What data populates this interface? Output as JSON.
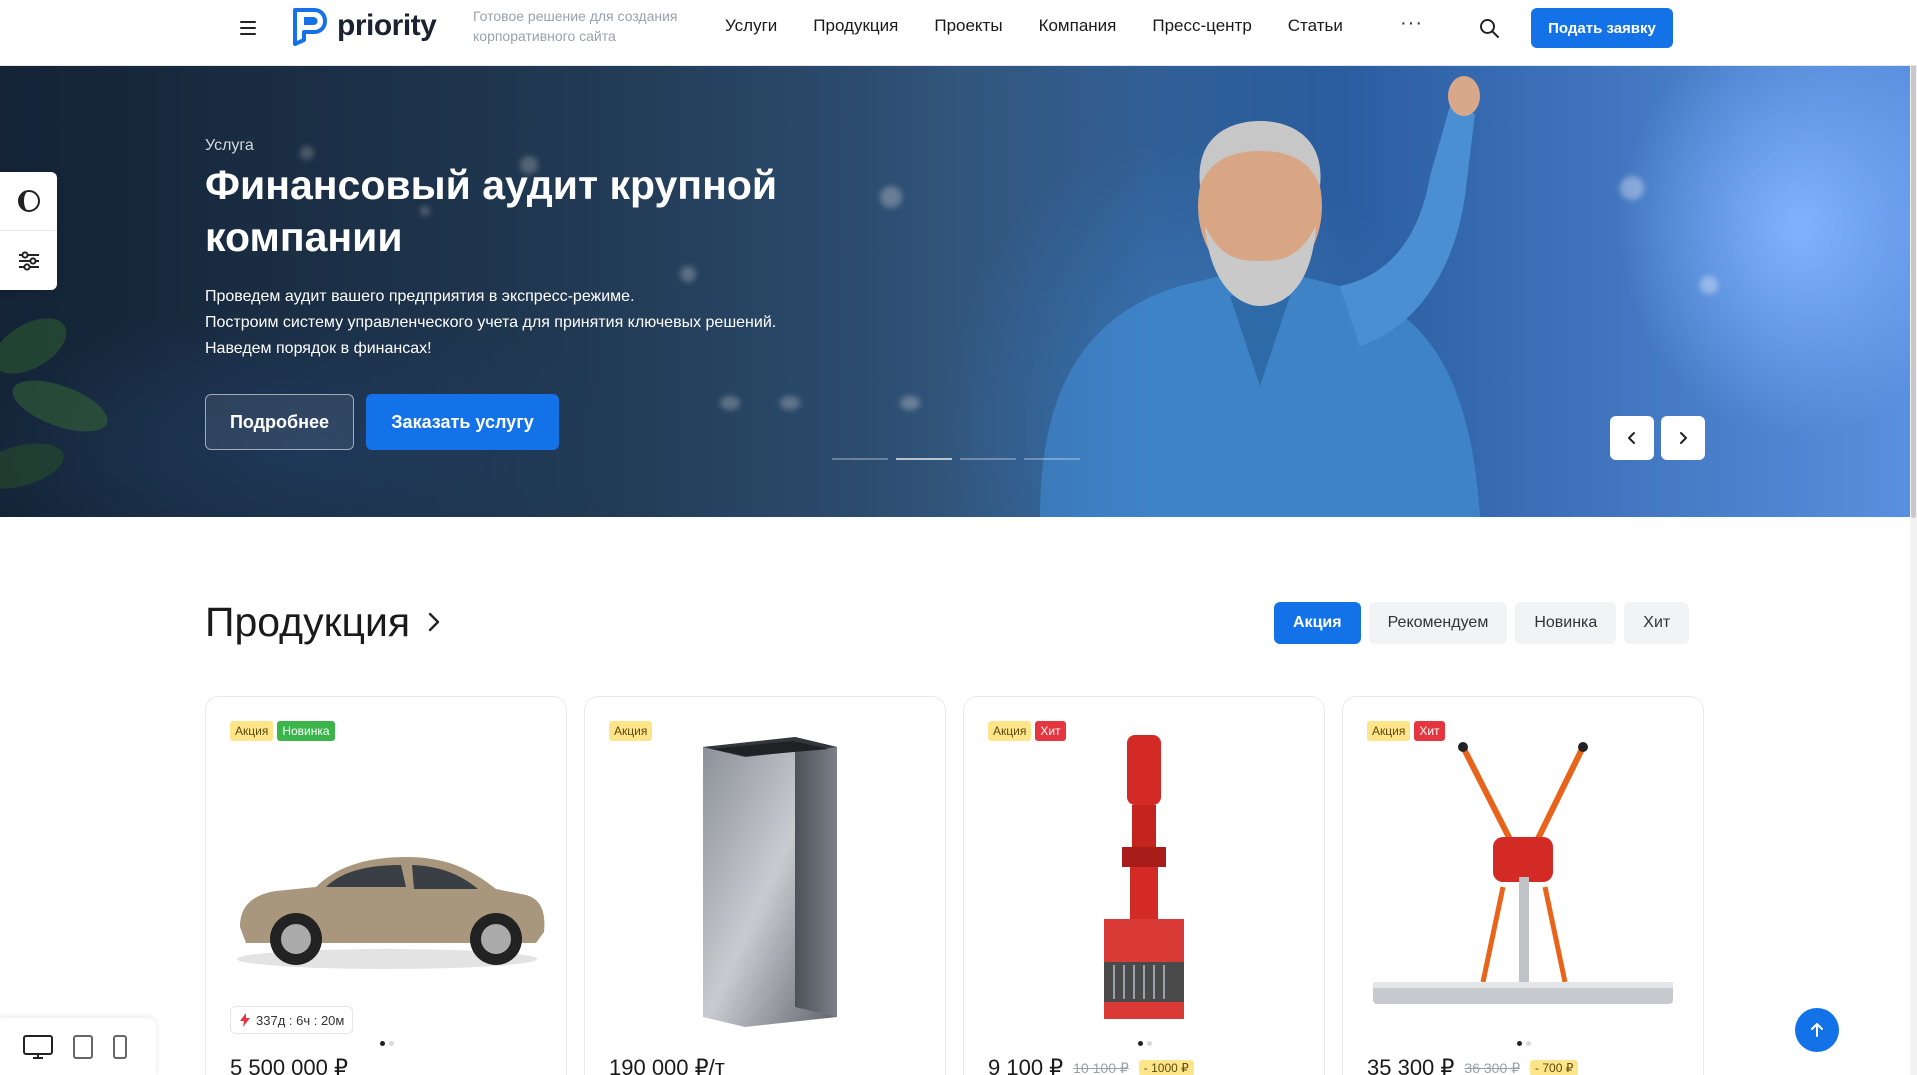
{
  "header": {
    "logo_text": "priority",
    "tagline": "Готовое решение для создания корпоративного сайта",
    "nav": [
      "Услуги",
      "Продукция",
      "Проекты",
      "Компания",
      "Пресс-центр",
      "Статьи"
    ],
    "more": "···",
    "apply_label": "Подать заявку"
  },
  "hero": {
    "eyebrow": "Услуга",
    "title": "Финансовый аудит крупной компании",
    "desc": [
      "Проведем аудит вашего предприятия в экспресс-режиме.",
      "Построим систему управленческого учета для принятия ключевых решений.",
      "Наведем порядок в финансах!"
    ],
    "more_label": "Подробнее",
    "order_label": "Заказать услугу",
    "slides_count": 4,
    "active_slide": 2
  },
  "products": {
    "title": "Продукция",
    "filters": [
      "Акция",
      "Рекомендуем",
      "Новинка",
      "Хит"
    ],
    "active_filter": "Акция",
    "items": [
      {
        "badges": [
          {
            "label": "Акция",
            "type": "sale"
          },
          {
            "label": "Новинка",
            "type": "new"
          }
        ],
        "image": "car",
        "timer": "337д : 6ч : 20м",
        "price": "5 500 000 ₽",
        "old_price": "",
        "diff": ""
      },
      {
        "badges": [
          {
            "label": "Акция",
            "type": "sale"
          }
        ],
        "image": "steel-profile-pipe",
        "timer": "",
        "price": "190 000 ₽/т",
        "old_price": "",
        "diff": ""
      },
      {
        "badges": [
          {
            "label": "Акция",
            "type": "sale"
          },
          {
            "label": "Хит",
            "type": "hit"
          }
        ],
        "image": "red-pump-grinder",
        "timer": "",
        "price": "9 100 ₽",
        "old_price": "10 100 ₽",
        "diff": "- 1000 ₽"
      },
      {
        "badges": [
          {
            "label": "Акция",
            "type": "sale"
          },
          {
            "label": "Хит",
            "type": "hit"
          }
        ],
        "image": "concrete-screed-vibrator",
        "timer": "",
        "price": "35 300 ₽",
        "old_price": "36 300 ₽",
        "diff": "- 700 ₽"
      }
    ]
  },
  "colors": {
    "accent": "#1472e8",
    "badge_sale": "#ffe589",
    "badge_new": "#3bb44a",
    "badge_hit": "#e5363f"
  }
}
